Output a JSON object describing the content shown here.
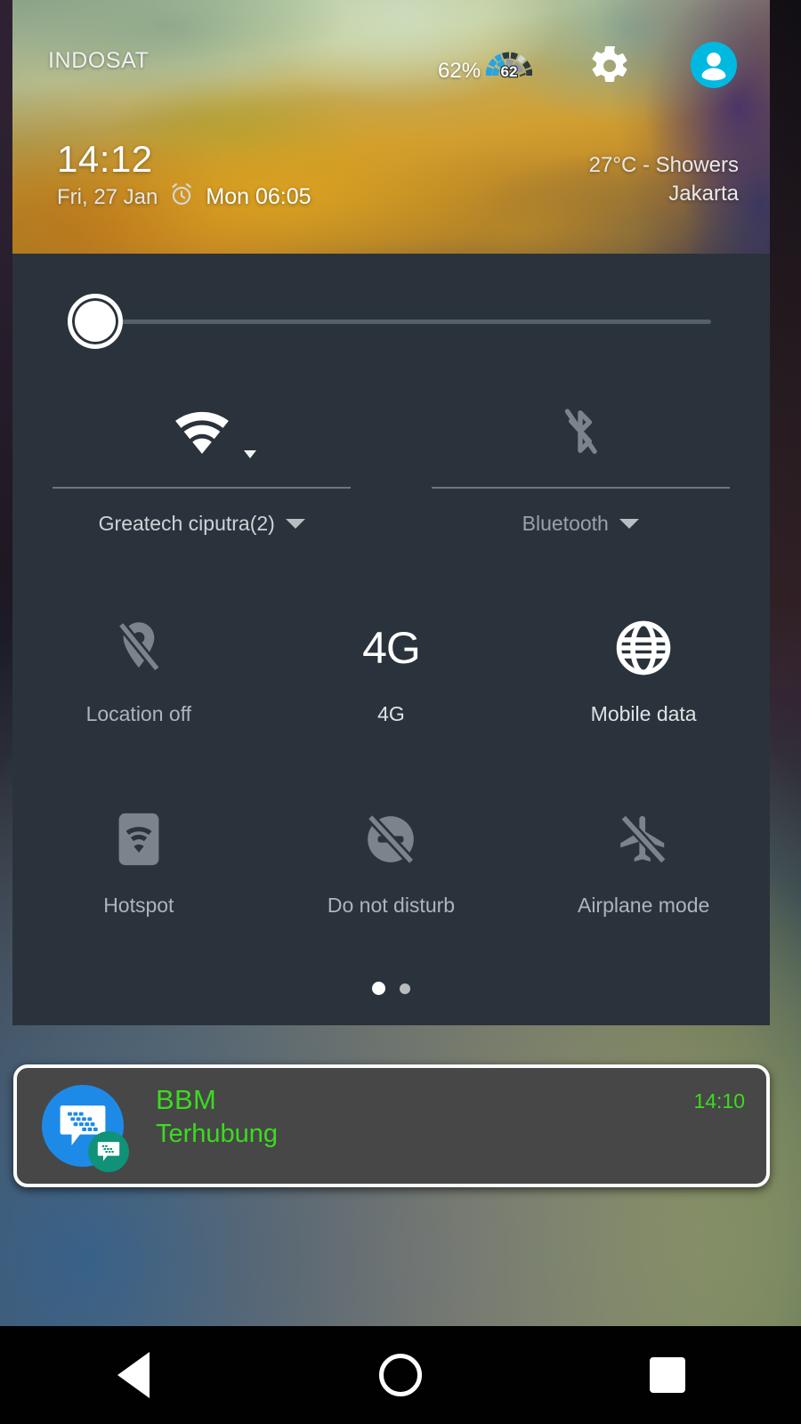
{
  "status": {
    "carrier": "INDOSAT",
    "battery_percent_label": "62%",
    "battery_level": 62,
    "battery_gauge_value": "62",
    "gear_icon": "gear-icon",
    "avatar_icon": "user-avatar-icon"
  },
  "header": {
    "clock": "14:12",
    "date": "Fri, 27 Jan",
    "alarm_icon": "alarm-clock-icon",
    "alarm_time": "Mon 06:05",
    "weather_line1": "27°C - Showers",
    "weather_line2": "Jakarta"
  },
  "brightness": {
    "label": "brightness-slider",
    "value": 0
  },
  "tiles_top": [
    {
      "id": "wifi",
      "icon": "wifi-icon",
      "label": "Greatech ciputra(2)",
      "state": "on",
      "has_caret": true
    },
    {
      "id": "bluetooth",
      "icon": "bluetooth-off-icon",
      "label": "Bluetooth",
      "state": "off",
      "has_caret": true
    }
  ],
  "tiles_middle": [
    {
      "id": "location",
      "icon": "location-off-icon",
      "label": "Location off",
      "state": "off"
    },
    {
      "id": "network_mode",
      "icon": "4g-text-icon",
      "label": "4G",
      "state": "on",
      "glyph": "4G"
    },
    {
      "id": "mobile_data",
      "icon": "globe-icon",
      "label": "Mobile data",
      "state": "on"
    }
  ],
  "tiles_bottom": [
    {
      "id": "hotspot",
      "icon": "hotspot-icon",
      "label": "Hotspot",
      "state": "off"
    },
    {
      "id": "dnd",
      "icon": "do-not-disturb-off-icon",
      "label": "Do not disturb",
      "state": "off"
    },
    {
      "id": "airplane",
      "icon": "airplane-mode-icon",
      "label": "Airplane mode",
      "state": "off"
    }
  ],
  "pagination": {
    "pages": 2,
    "active": 1
  },
  "notification": {
    "app_icon": "bbm-app-icon",
    "badge_icon": "bbm-badge-icon",
    "title": "BBM",
    "body": "Terhubung",
    "time": "14:10"
  },
  "navbar": {
    "back": "back-button",
    "home": "home-button",
    "recents": "recents-button"
  },
  "colors": {
    "panel_bg": "#2a333b",
    "notification_bg": "#474747",
    "notification_text": "#3bdb1f",
    "accent_avatar": "#00b7dd",
    "bbm_blue": "#1e8ae8",
    "tile_on": "#ffffff",
    "tile_off": "#7b848c"
  }
}
